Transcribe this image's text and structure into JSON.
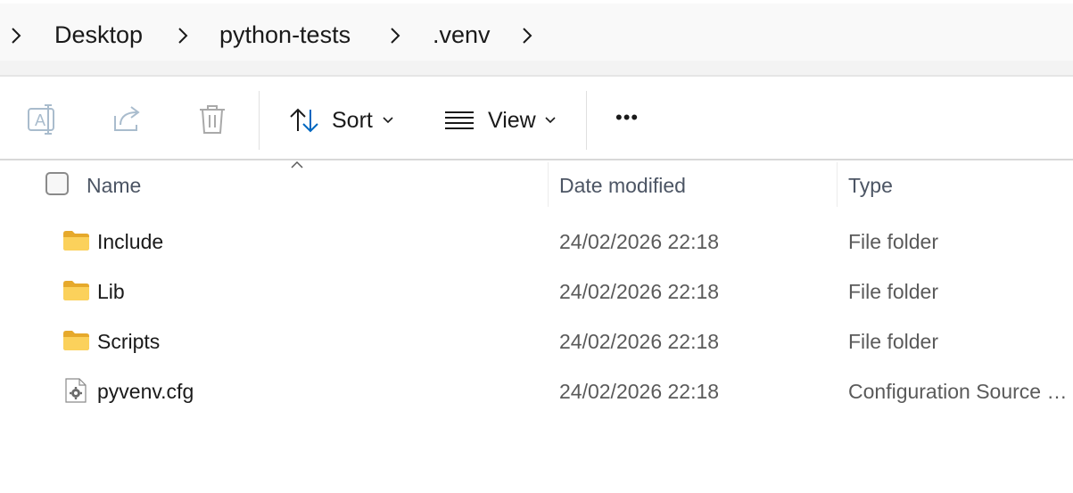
{
  "breadcrumb": {
    "items": [
      {
        "label": "Desktop"
      },
      {
        "label": "python-tests"
      },
      {
        "label": ".venv"
      }
    ]
  },
  "command_bar": {
    "rename_icon": "rename-icon",
    "share_icon": "share-icon",
    "delete_icon": "trash-icon",
    "sort_label": "Sort",
    "view_label": "View",
    "more_label": "•••"
  },
  "columns": {
    "name": "Name",
    "date_modified": "Date modified",
    "type": "Type"
  },
  "files": [
    {
      "name": "Include",
      "date": "24/02/2026 22:18",
      "type": "File folder",
      "icon": "folder-icon"
    },
    {
      "name": "Lib",
      "date": "24/02/2026 22:18",
      "type": "File folder",
      "icon": "folder-icon"
    },
    {
      "name": "Scripts",
      "date": "24/02/2026 22:18",
      "type": "File folder",
      "icon": "folder-icon"
    },
    {
      "name": "pyvenv.cfg",
      "date": "24/02/2026 22:18",
      "type": "Configuration Source File",
      "icon": "config-file-icon"
    }
  ],
  "colors": {
    "folder": "#f6c343",
    "accent": "#0067c0",
    "disabled_icon": "#9fb4c7"
  }
}
